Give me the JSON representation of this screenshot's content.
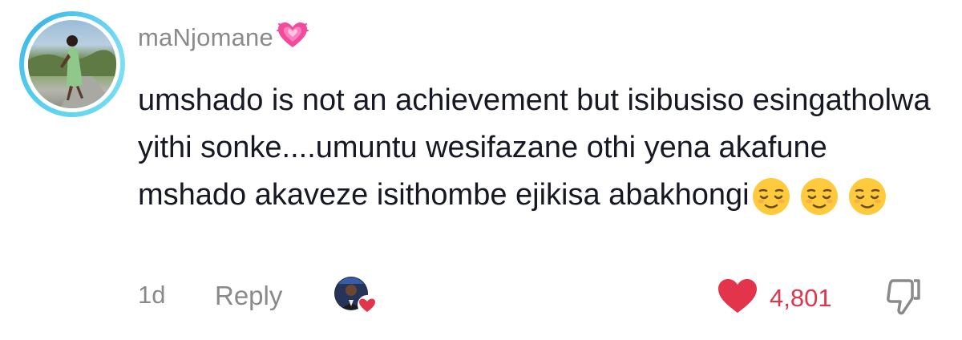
{
  "comment": {
    "username": "maNjomane",
    "text": "umshado is not an achievement but isibusiso esingatholwa yithi sonke....umuntu wesifazane othi yena akafune mshado akaveze isithombe ejikisa abakhongi",
    "trailing_emojis": [
      "relieved-face",
      "relieved-face",
      "relieved-face"
    ],
    "time": "1d",
    "reply_label": "Reply",
    "like_count": "4,801",
    "liked": true
  },
  "colors": {
    "accent_like": "#e2344b",
    "muted_text": "#8a8a8a",
    "avatar_ring": "#3ab8e8"
  },
  "icons": {
    "username_badge": "growing-heart-icon",
    "creator_liked_badge": "heart-icon",
    "like": "heart-filled-icon",
    "dislike": "thumbs-down-icon"
  }
}
